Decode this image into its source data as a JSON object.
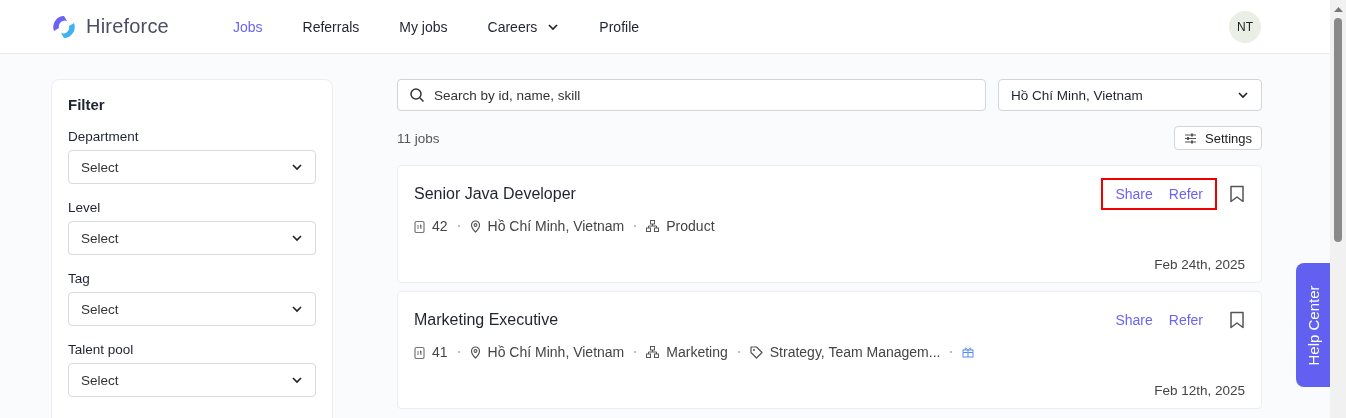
{
  "brand": {
    "name": "Hireforce"
  },
  "nav": [
    {
      "label": "Jobs",
      "selected": true,
      "dropdown": false
    },
    {
      "label": "Referrals",
      "selected": false,
      "dropdown": false
    },
    {
      "label": "My jobs",
      "selected": false,
      "dropdown": false
    },
    {
      "label": "Careers",
      "selected": false,
      "dropdown": true
    },
    {
      "label": "Profile",
      "selected": false,
      "dropdown": false
    }
  ],
  "user": {
    "initials": "NT"
  },
  "filter": {
    "title": "Filter",
    "fields": [
      {
        "label": "Department",
        "placeholder": "Select"
      },
      {
        "label": "Level",
        "placeholder": "Select"
      },
      {
        "label": "Tag",
        "placeholder": "Select"
      },
      {
        "label": "Talent pool",
        "placeholder": "Select"
      }
    ]
  },
  "search": {
    "placeholder": "Search by id, name, skill"
  },
  "location_select": {
    "value": "Hồ Chí Minh, Vietnam"
  },
  "job_count": "11 jobs",
  "settings_button": "Settings",
  "jobs": [
    {
      "title": "Senior Java Developer",
      "id": "42",
      "location": "Hồ Chí Minh, Vietnam",
      "department": "Product",
      "gift": false,
      "share": "Share",
      "refer": "Refer",
      "highlighted": true,
      "date": "Feb 24th, 2025"
    },
    {
      "title": "Marketing Executive",
      "id": "41",
      "location": "Hồ Chí Minh, Vietnam",
      "department": "Marketing",
      "tags": "Strategy, Team Managem...",
      "gift": true,
      "share": "Share",
      "refer": "Refer",
      "highlighted": false,
      "date": "Feb 12th, 2025"
    }
  ],
  "help_center": "Help Center"
}
